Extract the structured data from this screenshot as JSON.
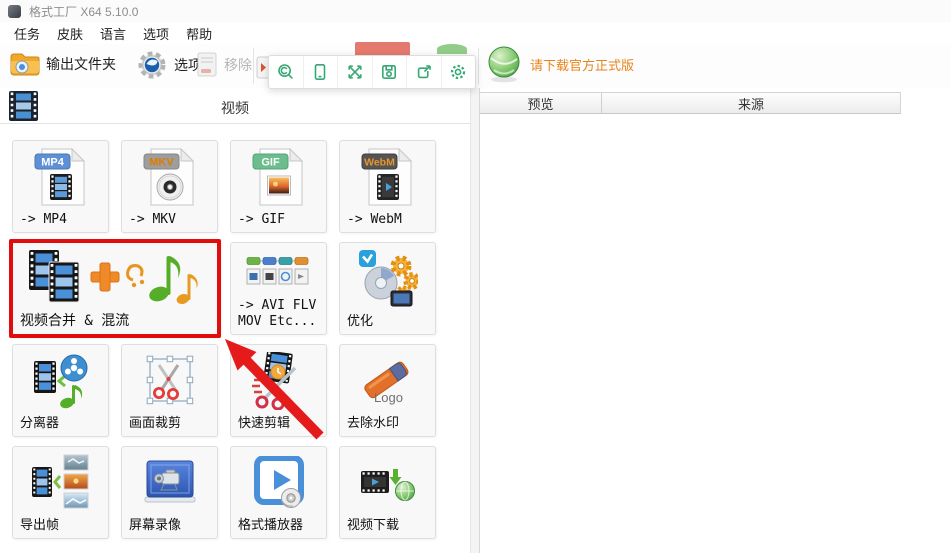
{
  "window": {
    "title": "格式工厂 X64 5.10.0"
  },
  "menubar": {
    "items": [
      "任务",
      "皮肤",
      "语言",
      "选项",
      "帮助"
    ]
  },
  "toolbar": {
    "output_folder_label": "输出文件夹",
    "options_label": "选项",
    "remove_label": "移除"
  },
  "overlay_toolbar": {
    "icons": [
      "search",
      "mobile-device",
      "fullscreen",
      "save",
      "export",
      "settings"
    ],
    "icon_color": "#35a873"
  },
  "trial_notice": {
    "text": "请下载官方正式版",
    "color": "#e8841a"
  },
  "left_panel": {
    "section_title": "视频"
  },
  "right_panel": {
    "columns": [
      "预览",
      "来源"
    ]
  },
  "grid": {
    "cells": [
      {
        "label": "-> MP4",
        "badge": "MP4"
      },
      {
        "label": "-> MKV",
        "badge": "MKV"
      },
      {
        "label": "-> GIF",
        "badge": "GIF"
      },
      {
        "label": "-> WebM",
        "badge": "WebM"
      },
      {
        "label": "视频合并 & 混流",
        "highlighted": true
      },
      {
        "label": "-> AVI FLV\nMOV Etc..."
      },
      {
        "label": "优化"
      },
      {
        "label": "分离器"
      },
      {
        "label": "画面裁剪"
      },
      {
        "label": "快速剪辑"
      },
      {
        "label": "去除水印",
        "icon_text": "Logo"
      },
      {
        "label": "导出帧"
      },
      {
        "label": "屏幕录像"
      },
      {
        "label": "格式播放器"
      },
      {
        "label": "视频下载"
      }
    ]
  },
  "colors": {
    "highlight_red": "#e00d0d",
    "trial_orange": "#e8841a",
    "toolbar_icon_green": "#35a873"
  }
}
